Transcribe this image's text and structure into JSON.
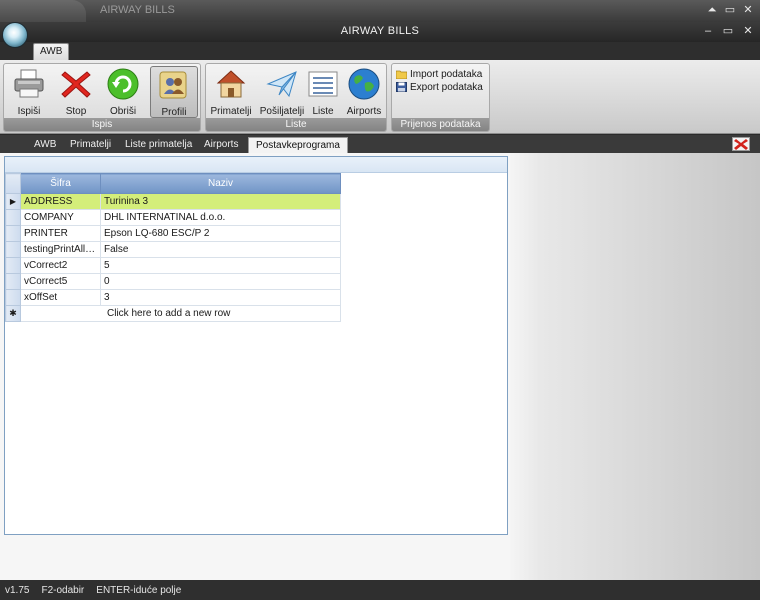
{
  "outer_title": "AIRWAY BILLS",
  "outer_controls": [
    "⏶",
    "▭",
    "✕"
  ],
  "app_title": "AIRWAY BILLS",
  "app_controls": [
    "–",
    "▭",
    "✕"
  ],
  "ribbon": {
    "tab": "AWB",
    "groups": [
      {
        "caption": "Ispis",
        "buttons": [
          "Ispiši",
          "Stop",
          "Obriši",
          "Profili"
        ]
      },
      {
        "caption": "Liste",
        "buttons": [
          "Primatelji",
          "Pošiljatelji",
          "Liste",
          "Airports"
        ]
      },
      {
        "caption": "Prijenos podataka",
        "buttons": [
          "Import podataka",
          "Export podataka"
        ]
      }
    ]
  },
  "doc_tabs": [
    "AWB",
    "Primatelji",
    "Liste primatelja",
    "Airports",
    "Postavkeprograma"
  ],
  "grid": {
    "columns": [
      "Šifra",
      "Naziv"
    ],
    "rows": [
      {
        "sifra": "ADDRESS",
        "naziv": "Turinina 3"
      },
      {
        "sifra": "COMPANY",
        "naziv": "DHL INTERNATINAL d.o.o."
      },
      {
        "sifra": "PRINTER",
        "naziv": "Epson LQ-680 ESC/P 2"
      },
      {
        "sifra": "testingPrintAllO...",
        "naziv": "False"
      },
      {
        "sifra": "vCorrect2",
        "naziv": "5"
      },
      {
        "sifra": "vCorrect5",
        "naziv": "0"
      },
      {
        "sifra": "xOffSet",
        "naziv": "3"
      }
    ],
    "new_row_text": "Click here to add a new row",
    "current_row_marker": "▶",
    "new_row_marker": "✱"
  },
  "status": [
    "v1.75",
    "F2-odabir",
    "ENTER-iduće polje"
  ]
}
